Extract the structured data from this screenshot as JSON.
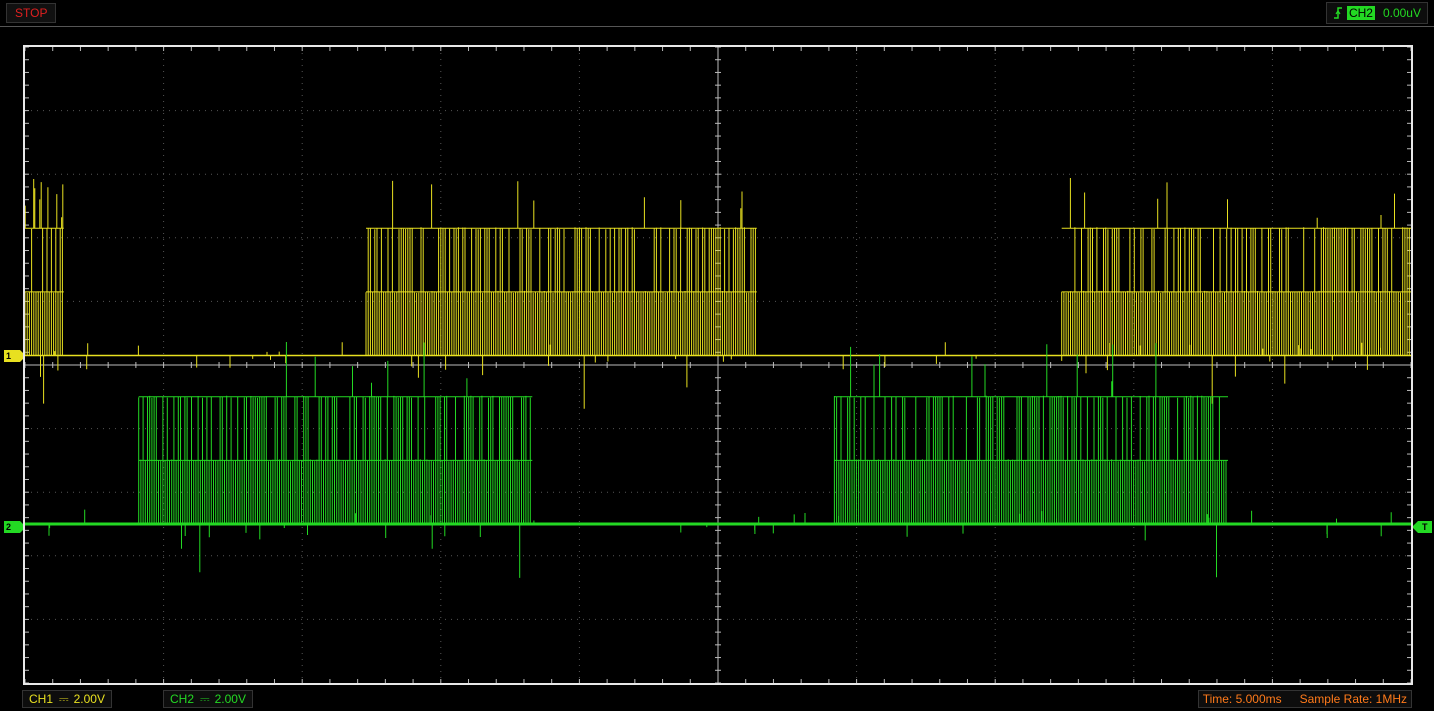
{
  "status": {
    "run_state": "STOP",
    "color": "#e02020"
  },
  "trigger": {
    "icon": "rising-edge-icon",
    "channel": "CH2",
    "level": "0.00uV"
  },
  "channels": [
    {
      "name": "CH1",
      "coupling": "DC",
      "volts_per_div": "2.00V",
      "color": "#e8e020",
      "marker": "1"
    },
    {
      "name": "CH2",
      "coupling": "DC",
      "volts_per_div": "2.00V",
      "color": "#23d923",
      "marker": "2"
    }
  ],
  "trigger_marker": "T",
  "timebase": {
    "time_label": "Time: 5.000ms",
    "sample_rate_label": "Sample Rate: 1MHz"
  },
  "grid": {
    "h_divisions": 10,
    "v_divisions": 10
  },
  "chart_data": {
    "type": "line",
    "x_unit": "ms",
    "xlim": [
      0,
      50
    ],
    "ylim": [
      -5,
      5
    ],
    "series": [
      {
        "name": "CH1",
        "color": "#e8e020",
        "baseline_div": 0.15,
        "bursts_ms": [
          [
            0,
            1.4
          ],
          [
            12.3,
            26.4
          ],
          [
            37.4,
            50
          ]
        ],
        "high_div": 2.0,
        "mid_div": 1.0
      },
      {
        "name": "CH2",
        "color": "#23d923",
        "baseline_div": -2.5,
        "bursts_ms": [
          [
            4.1,
            18.3
          ],
          [
            29.2,
            43.4
          ]
        ],
        "high_div": 2.0,
        "mid_div": 1.0
      }
    ]
  }
}
